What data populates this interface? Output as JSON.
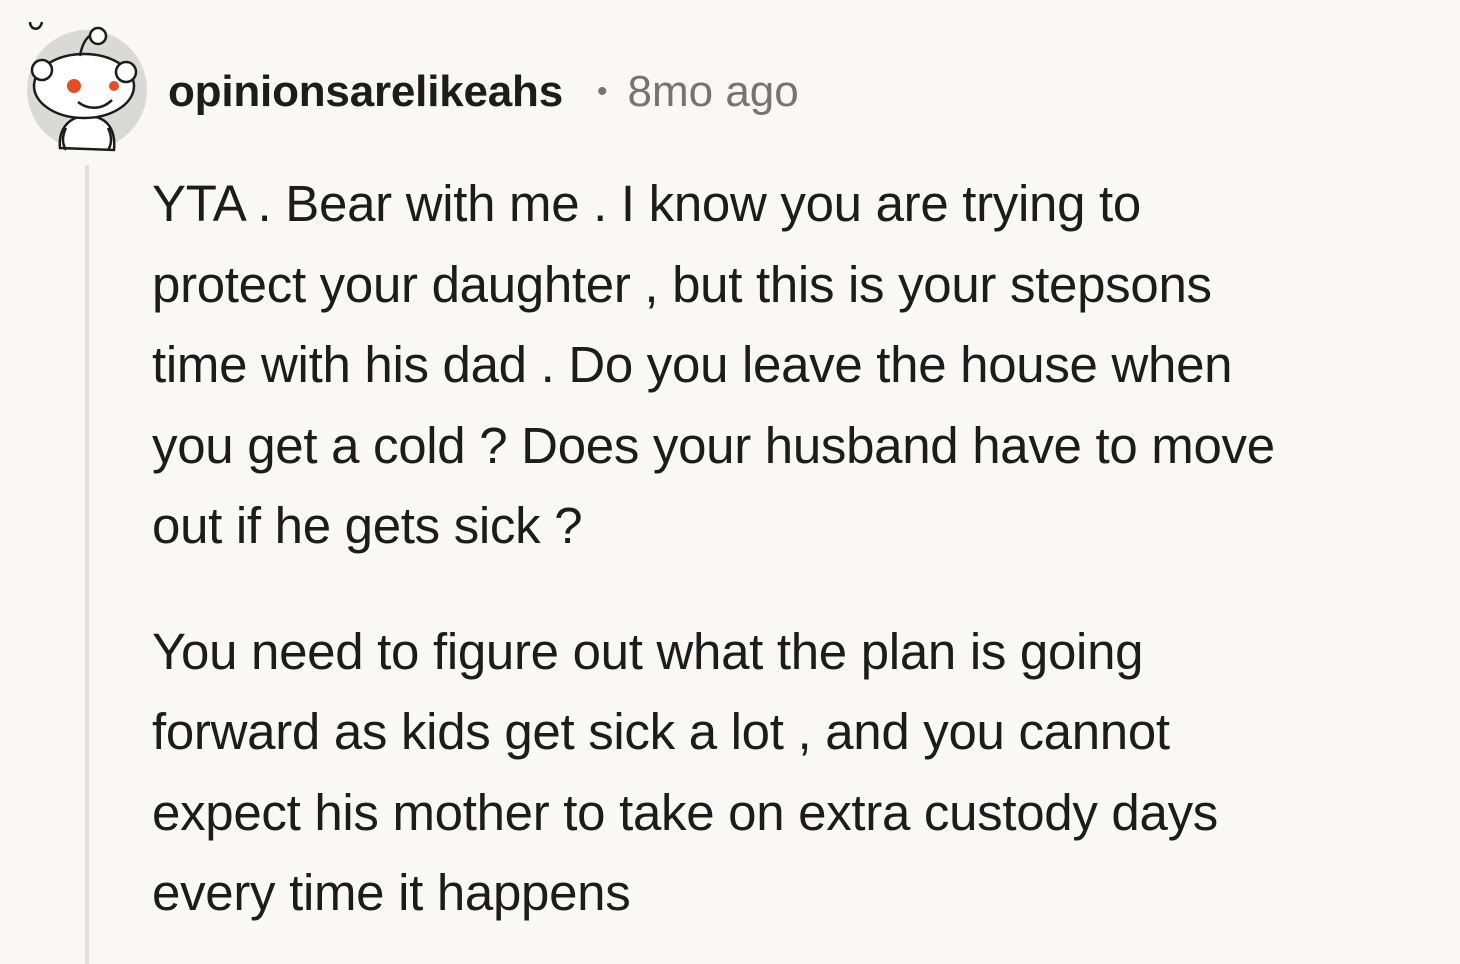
{
  "comment": {
    "author": "opinionsarelikeahs",
    "separator": "•",
    "timestamp": "8mo ago",
    "avatar_icon": "reddit-snoo-avatar-icon",
    "paragraphs": [
      {
        "lines": [
          "YTA . Bear with me . I know you are trying to",
          "protect your daughter , but this is your stepsons",
          "time with his dad . Do you leave the house when",
          "you get a cold ? Does your husband have to move",
          "out if he gets sick ?"
        ]
      },
      {
        "lines": [
          "You need to figure out what the plan is going",
          "forward as kids get sick a lot , and you cannot",
          "expect his mother to take on extra custody days",
          "every time it happens"
        ]
      }
    ]
  },
  "colors": {
    "background": "#f9f8f6",
    "text": "#1c1c1c",
    "meta": "#7b7269",
    "thread_line": "#e6dfd9",
    "avatar_accent": "#e04f25"
  }
}
